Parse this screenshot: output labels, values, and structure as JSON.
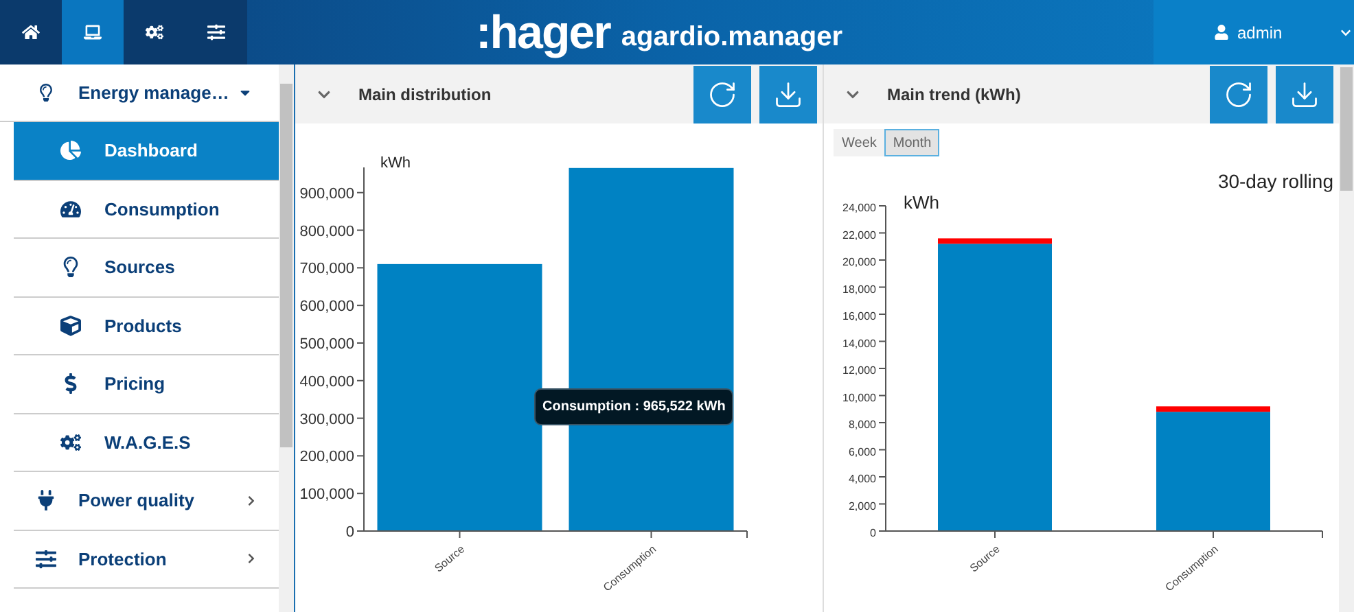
{
  "header": {
    "nav_tabs": [
      {
        "kind": "home",
        "selected": false
      },
      {
        "kind": "laptop",
        "selected": true
      },
      {
        "kind": "gears",
        "selected": false
      },
      {
        "kind": "sliders",
        "selected": false
      }
    ],
    "logo": ":hager",
    "product": "agardio.manager",
    "user": "admin"
  },
  "sidebar": {
    "section": {
      "label": "Energy manage…",
      "expanded": true
    },
    "items": [
      {
        "label": "Dashboard",
        "kind": "sub",
        "selected": true
      },
      {
        "label": "Consumption",
        "kind": "sub",
        "selected": false
      },
      {
        "label": "Sources",
        "kind": "sub",
        "selected": false
      },
      {
        "label": "Products",
        "kind": "sub",
        "selected": false
      },
      {
        "label": "Pricing",
        "kind": "sub",
        "selected": false
      },
      {
        "label": "W.A.G.E.S",
        "kind": "sub",
        "selected": false
      },
      {
        "label": "Power quality",
        "kind": "group",
        "selected": false
      },
      {
        "label": "Protection",
        "kind": "group",
        "selected": false
      }
    ]
  },
  "panels": [
    {
      "title": "Main distribution",
      "tooltip": "Consumption : 965,522 kWh",
      "chart_data": {
        "type": "bar",
        "ylabel": "kWh",
        "categories": [
          "Source",
          "Consumption"
        ],
        "series": [
          {
            "color": "#0082c3",
            "values": [
              710000,
              965522
            ]
          }
        ],
        "ylim": [
          0,
          967000
        ],
        "yticks": [
          {
            "value": 0,
            "label": "0"
          },
          {
            "value": 100000,
            "label": "100,000"
          },
          {
            "value": 200000,
            "label": "200,000"
          },
          {
            "value": 300000,
            "label": "300,000"
          },
          {
            "value": 400000,
            "label": "400,000"
          },
          {
            "value": 500000,
            "label": "500,000"
          },
          {
            "value": 600000,
            "label": "600,000"
          },
          {
            "value": 700000,
            "label": "700,000"
          },
          {
            "value": 800000,
            "label": "800,000"
          },
          {
            "value": 900000,
            "label": "900,000"
          }
        ]
      }
    },
    {
      "title": "Main trend (kWh)",
      "periods": [
        {
          "label": "Week",
          "selected": false
        },
        {
          "label": "Month",
          "selected": true
        }
      ],
      "chart_data": {
        "type": "bar",
        "title": "30-day rolling",
        "ylabel": "kWh",
        "categories": [
          "Source",
          "Consumption"
        ],
        "stacked": true,
        "series": [
          {
            "color": "#0082c3",
            "values": [
              21200,
              8800
            ]
          },
          {
            "color": "#ff0000",
            "values": [
              400,
              400
            ]
          }
        ],
        "ylim": [
          0,
          24000
        ],
        "yticks": [
          {
            "value": 0,
            "label": "0"
          },
          {
            "value": 2000,
            "label": "2,000"
          },
          {
            "value": 4000,
            "label": "4,000"
          },
          {
            "value": 6000,
            "label": "6,000"
          },
          {
            "value": 8000,
            "label": "8,000"
          },
          {
            "value": 10000,
            "label": "10,000"
          },
          {
            "value": 12000,
            "label": "12,000"
          },
          {
            "value": 14000,
            "label": "14,000"
          },
          {
            "value": 16000,
            "label": "16,000"
          },
          {
            "value": 18000,
            "label": "18,000"
          },
          {
            "value": 20000,
            "label": "20,000"
          },
          {
            "value": 22000,
            "label": "22,000"
          },
          {
            "value": 24000,
            "label": "24,000"
          }
        ]
      }
    }
  ]
}
